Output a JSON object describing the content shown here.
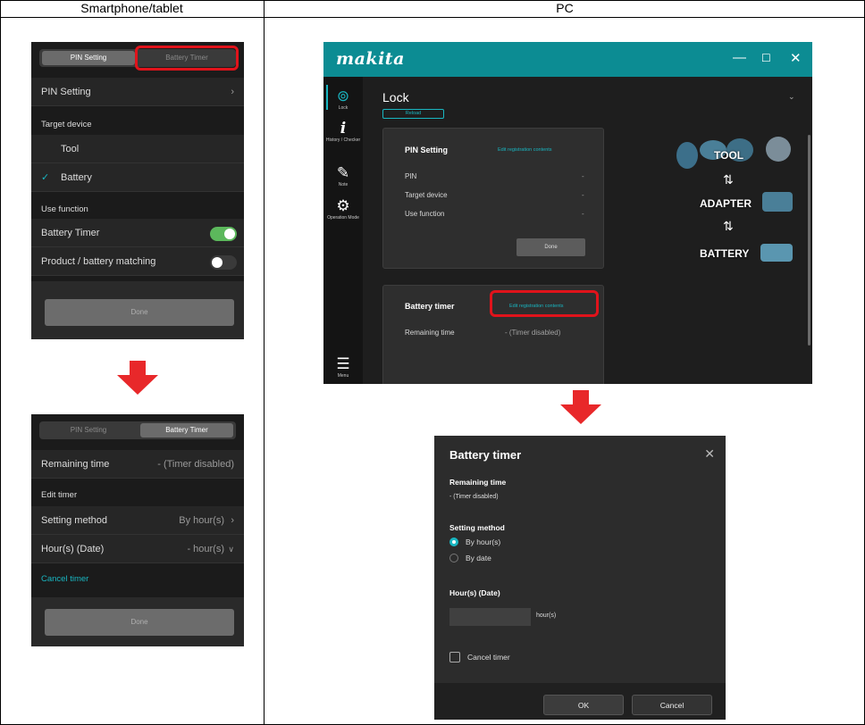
{
  "table": {
    "col_left": "Smartphone/tablet",
    "col_right": "PC"
  },
  "phone1": {
    "tabs": [
      "PIN Setting",
      "Battery Timer"
    ],
    "pin_setting_row": "PIN Setting",
    "target_device_header": "Target device",
    "tool_option": "Tool",
    "battery_option": "Battery",
    "check_mark": "✓",
    "use_function_header": "Use function",
    "battery_timer_label": "Battery Timer",
    "battery_timer_on": true,
    "product_matching_label": "Product / battery matching",
    "product_matching_on": false,
    "done_label": "Done"
  },
  "phone2": {
    "tabs": [
      "PIN Setting",
      "Battery Timer"
    ],
    "remaining_label": "Remaining time",
    "remaining_value": "- (Timer disabled)",
    "edit_timer_header": "Edit timer",
    "setting_method_label": "Setting method",
    "setting_method_value": "By hour(s)",
    "hours_label": "Hour(s) (Date)",
    "hours_value": "- hour(s)",
    "cancel_timer": "Cancel timer",
    "done_label": "Done"
  },
  "pc": {
    "logo": "makita",
    "window_controls": [
      "—",
      "☐",
      "✕"
    ],
    "sidebar": [
      {
        "icon": "lock-icon",
        "label": "Lock"
      },
      {
        "icon": "info-icon",
        "label": "History / Checker"
      },
      {
        "icon": "note-icon",
        "label": "Note"
      },
      {
        "icon": "operation-mode-icon",
        "label": "Operation Mode"
      },
      {
        "icon": "menu-icon",
        "label": "Menu"
      }
    ],
    "page_title": "Lock",
    "reload_label": "Reload",
    "pin_card": {
      "title": "PIN Setting",
      "edit_link": "Edit registration contents",
      "rows": [
        {
          "label": "PIN",
          "value": "-"
        },
        {
          "label": "Target device",
          "value": "-"
        },
        {
          "label": "Use function",
          "value": "-"
        }
      ],
      "done_label": "Done"
    },
    "battery_card": {
      "title": "Battery timer",
      "edit_link": "Edit registration contents",
      "remaining_label": "Remaining time",
      "remaining_value": "- (Timer disabled)"
    },
    "graphic_labels": [
      "TOOL",
      "ADAPTER",
      "BATTERY"
    ]
  },
  "dialog": {
    "title": "Battery timer",
    "remaining_label": "Remaining time",
    "remaining_value": "- (Timer disabled)",
    "setting_method_label": "Setting method",
    "option_hours": "By hour(s)",
    "option_date": "By date",
    "selected_option": "By hour(s)",
    "hours_label": "Hour(s) (Date)",
    "hours_value": "",
    "hours_unit": "hour(s)",
    "cancel_timer_label": "Cancel timer",
    "cancel_timer_checked": false,
    "ok_label": "OK",
    "cancel_label": "Cancel"
  },
  "colors": {
    "accent_teal": "#19b6c1",
    "title_bar": "#0c8c93",
    "highlight_red": "#e0131b",
    "toggle_on": "#5cb85c"
  }
}
